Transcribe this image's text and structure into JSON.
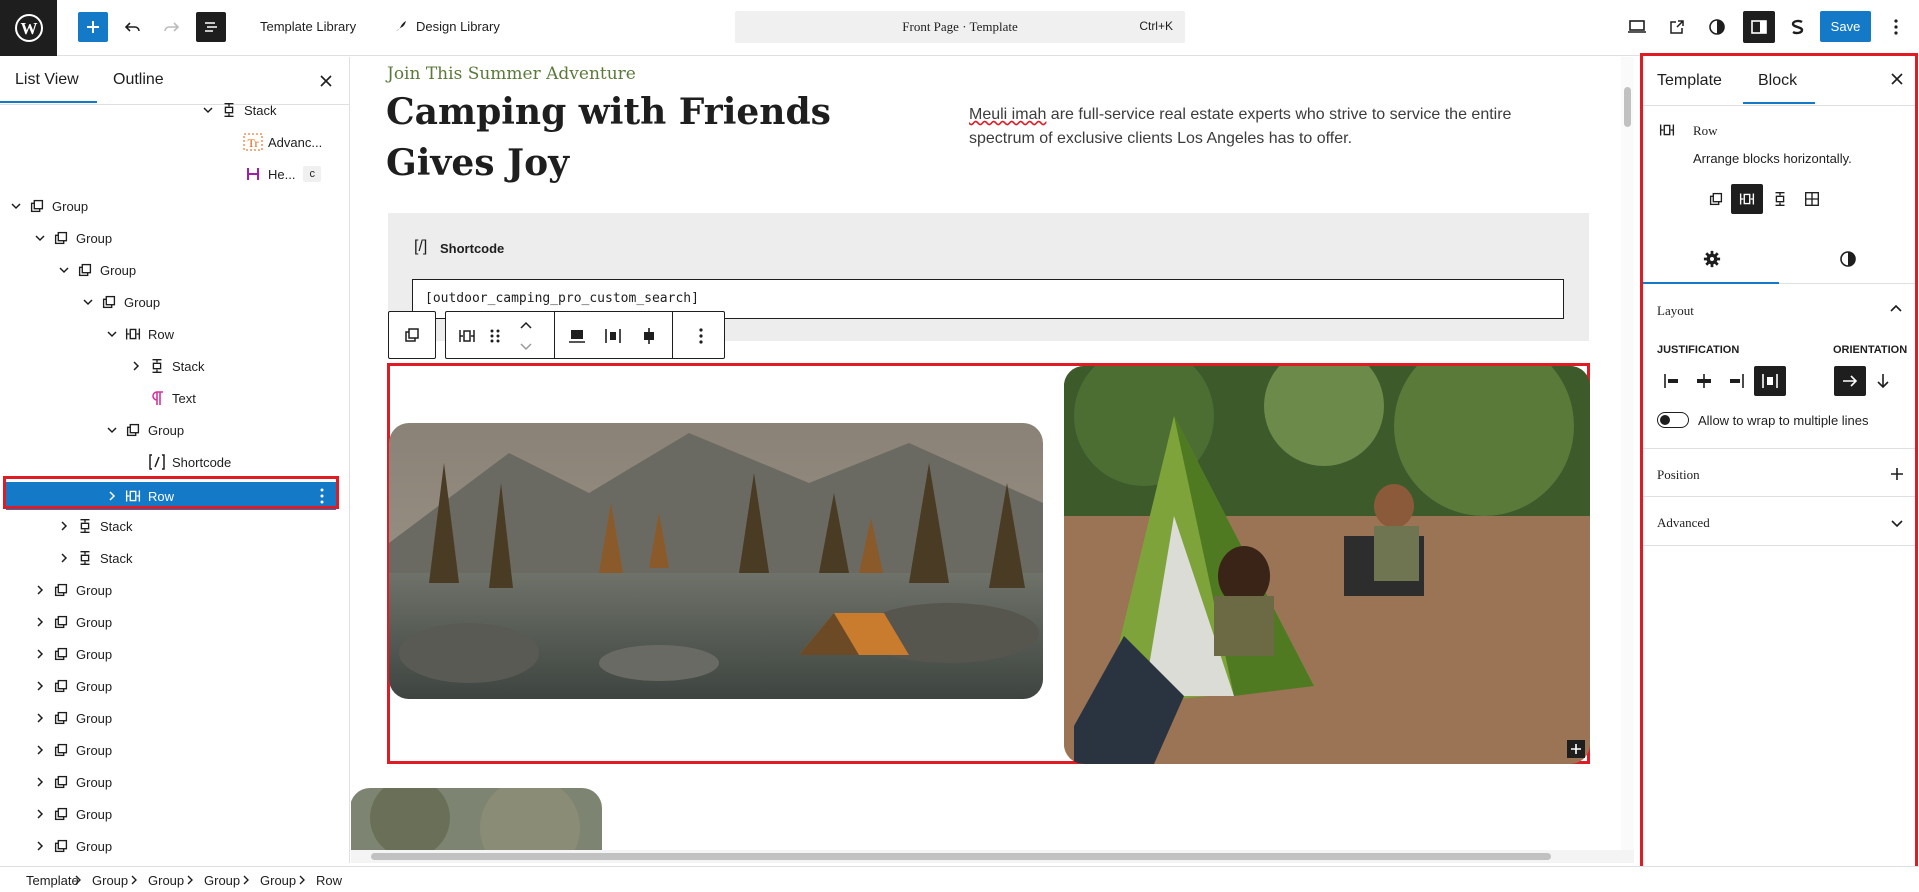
{
  "topbar": {
    "template_library": "Template Library",
    "design_library": "Design Library",
    "command_title": "Front Page · Template",
    "command_shortcut": "Ctrl+K",
    "save_label": "Save"
  },
  "left_panel": {
    "tabs": [
      "List View",
      "Outline"
    ],
    "tree": [
      {
        "label": "Stack",
        "icon": "stack-icon",
        "chevron": "down"
      },
      {
        "label": "Advanc...",
        "icon": "heading-text-icon"
      },
      {
        "label": "He...",
        "icon": "heading-icon",
        "badge": "c"
      },
      {
        "label": "Group",
        "icon": "group-icon",
        "chevron": "down"
      },
      {
        "label": "Group",
        "icon": "group-icon",
        "chevron": "down"
      },
      {
        "label": "Group",
        "icon": "group-icon",
        "chevron": "down"
      },
      {
        "label": "Group",
        "icon": "group-icon",
        "chevron": "down"
      },
      {
        "label": "Row",
        "icon": "row-icon",
        "chevron": "down"
      },
      {
        "label": "Stack",
        "icon": "stack-icon",
        "chevron": "right"
      },
      {
        "label": "Text",
        "icon": "paragraph-icon"
      },
      {
        "label": "Group",
        "icon": "group-icon",
        "chevron": "down"
      },
      {
        "label": "Shortcode",
        "icon": "shortcode-icon"
      },
      {
        "label": "Row",
        "icon": "row-icon",
        "chevron": "right",
        "selected": true
      },
      {
        "label": "Stack",
        "icon": "stack-icon",
        "chevron": "right"
      },
      {
        "label": "Stack",
        "icon": "stack-icon",
        "chevron": "right"
      },
      {
        "label": "Group",
        "icon": "group-icon",
        "chevron": "right"
      },
      {
        "label": "Group",
        "icon": "group-icon",
        "chevron": "right"
      },
      {
        "label": "Group",
        "icon": "group-icon",
        "chevron": "right"
      },
      {
        "label": "Group",
        "icon": "group-icon",
        "chevron": "right"
      },
      {
        "label": "Group",
        "icon": "group-icon",
        "chevron": "right"
      },
      {
        "label": "Group",
        "icon": "group-icon",
        "chevron": "right"
      },
      {
        "label": "Group",
        "icon": "group-icon",
        "chevron": "right"
      },
      {
        "label": "Group",
        "icon": "group-icon",
        "chevron": "right"
      },
      {
        "label": "Group",
        "icon": "group-icon",
        "chevron": "right"
      }
    ]
  },
  "canvas": {
    "eyebrow": "Join This Summer Adventure",
    "heading": "Camping with Friends Gives Joy",
    "description_misspelled": "Meuli imah",
    "description_rest": " are full-service real estate experts who strive to service the entire spectrum of exclusive clients Los Angeles has to offer.",
    "shortcode_label": "Shortcode",
    "shortcode_glyph": "[/]",
    "shortcode_value": "[outdoor_camping_pro_custom_search]"
  },
  "right_panel": {
    "tabs": [
      "Template",
      "Block"
    ],
    "block_name": "Row",
    "block_description": "Arrange blocks horizontally.",
    "section_layout": "Layout",
    "justification_label": "JUSTIFICATION",
    "orientation_label": "ORIENTATION",
    "wrap_label": "Allow to wrap to multiple lines",
    "section_position": "Position",
    "section_advanced": "Advanced"
  },
  "breadcrumb": [
    "Template",
    "Group",
    "Group",
    "Group",
    "Group",
    "Row"
  ],
  "colors": {
    "accent": "#1479c7",
    "highlight": "#e01b24",
    "eyebrow": "#5b7a3a"
  }
}
